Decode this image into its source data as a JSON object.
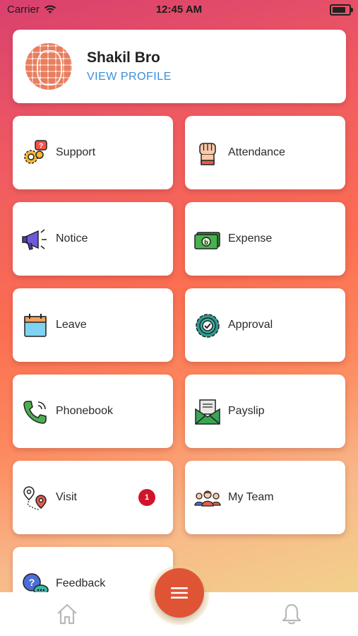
{
  "status_bar": {
    "carrier": "Carrier",
    "time": "12:45 AM"
  },
  "profile": {
    "name": "Shakil Bro",
    "link_label": "VIEW PROFILE"
  },
  "tiles": [
    {
      "label": "Support",
      "icon": "support-icon"
    },
    {
      "label": "Attendance",
      "icon": "fist-icon"
    },
    {
      "label": "Notice",
      "icon": "megaphone-icon"
    },
    {
      "label": "Expense",
      "icon": "money-icon"
    },
    {
      "label": "Leave",
      "icon": "calendar-icon"
    },
    {
      "label": "Approval",
      "icon": "check-gear-icon"
    },
    {
      "label": "Phonebook",
      "icon": "phone-icon"
    },
    {
      "label": "Payslip",
      "icon": "envelope-icon"
    },
    {
      "label": "Visit",
      "icon": "location-route-icon",
      "badge": "1"
    },
    {
      "label": "My Team",
      "icon": "team-icon"
    },
    {
      "label": "Feedback",
      "icon": "feedback-icon"
    }
  ],
  "bottom_nav": {
    "home": "home-icon",
    "menu": "menu-icon",
    "notifications": "bell-icon"
  },
  "colors": {
    "accent": "#e05436",
    "link": "#3a8fd8",
    "badge": "#d0152b"
  }
}
